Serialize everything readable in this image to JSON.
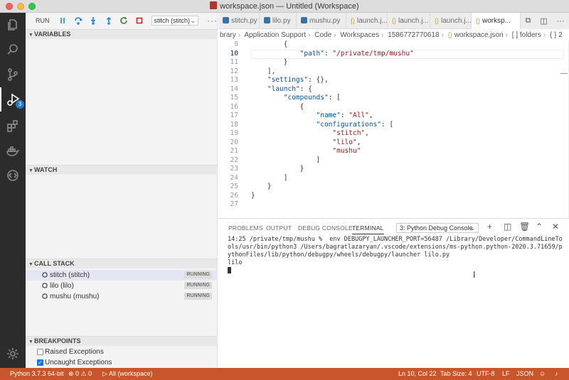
{
  "window": {
    "title": "workspace.json — Untitled (Workspace)"
  },
  "debug": {
    "run_label": "RUN",
    "config": "stitch (stitch)"
  },
  "sections": {
    "variables": "VARIABLES",
    "watch": "WATCH",
    "call_stack": "CALL STACK",
    "breakpoints": "BREAKPOINTS"
  },
  "call_stack": [
    {
      "name": "stitch (stitch)",
      "status": "RUNNING"
    },
    {
      "name": "lilo (lilo)",
      "status": "RUNNING"
    },
    {
      "name": "mushu (mushu)",
      "status": "RUNNING"
    }
  ],
  "breakpoints": [
    {
      "label": "Raised Exceptions",
      "checked": false
    },
    {
      "label": "Uncaught Exceptions",
      "checked": true
    }
  ],
  "activity": {
    "debug_badge": "3"
  },
  "tabs": [
    {
      "label": "stitch.py"
    },
    {
      "label": "lilo.py"
    },
    {
      "label": "mushu.py"
    },
    {
      "label": "launch.j..."
    },
    {
      "label": "launch.j..."
    },
    {
      "label": "launch.j..."
    },
    {
      "label": "worksp..."
    }
  ],
  "breadcrumb": [
    "brary",
    "Application Support",
    "Code",
    "Workspaces",
    "1586772770618",
    "workspace.json",
    "[ ] folders",
    "{ } 2"
  ],
  "code": [
    {
      "n": "9",
      "text": "        {"
    },
    {
      "n": "10",
      "text": "            \"path\": \"/private/tmp/mushu\""
    },
    {
      "n": "11",
      "text": "        }"
    },
    {
      "n": "12",
      "text": "    ],"
    },
    {
      "n": "13",
      "text": "    \"settings\": {},"
    },
    {
      "n": "14",
      "text": "    \"launch\": {"
    },
    {
      "n": "15",
      "text": "        \"compounds\": ["
    },
    {
      "n": "16",
      "text": "            {"
    },
    {
      "n": "17",
      "text": "                \"name\": \"All\","
    },
    {
      "n": "18",
      "text": "                \"configurations\": ["
    },
    {
      "n": "19",
      "text": "                    \"stitch\","
    },
    {
      "n": "20",
      "text": "                    \"lilo\","
    },
    {
      "n": "21",
      "text": "                    \"mushu\""
    },
    {
      "n": "22",
      "text": "                ]"
    },
    {
      "n": "23",
      "text": "            }"
    },
    {
      "n": "24",
      "text": "        ]"
    },
    {
      "n": "25",
      "text": "    }"
    },
    {
      "n": "26",
      "text": "}"
    },
    {
      "n": "27",
      "text": ""
    }
  ],
  "panel": {
    "tabs": [
      "PROBLEMS",
      "OUTPUT",
      "DEBUG CONSOLE",
      "TERMINAL"
    ],
    "terminal_select": "3: Python Debug Console",
    "terminal_lines": [
      "14:25 /private/tmp/mushu %  env DEBUGPY_LAUNCHER_PORT=56487 /Library/Developer/CommandLineTo",
      "ols/usr/bin/python3 /Users/bagratlazaryan/.vscode/extensions/ms-python.python-2020.3.71659/p",
      "ythonFiles/lib/python/debugpy/wheels/debugpy/launcher lilo.py",
      "lilo"
    ]
  },
  "status": {
    "python": "Python 3.7.3 64-bit",
    "errors": "0",
    "warnings": "0",
    "launch": "All (workspace)",
    "position": "Ln 10, Col 22",
    "tab_size": "Tab Size: 4",
    "encoding": "UTF-8",
    "eol": "LF",
    "language": "JSON"
  },
  "colors": {
    "status_bar": "#c8562a",
    "activity_bar": "#2c2c2c",
    "accent": "#1a85ff"
  }
}
